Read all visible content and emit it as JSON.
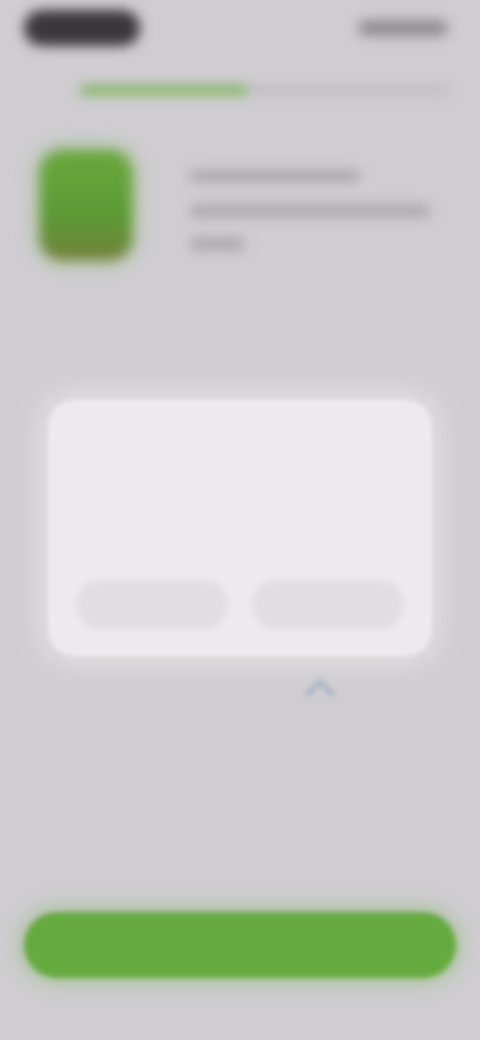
{
  "status_bar": {
    "time": "",
    "icons": "signal-wifi-battery"
  },
  "onboarding": {
    "progress": 0.45
  },
  "dialog": {
    "title": "",
    "body": "",
    "cancel_label": "",
    "confirm_label": ""
  },
  "cta": {
    "label": ""
  },
  "colors": {
    "accent": "#64aa3f",
    "background": "#cfcdd1",
    "dialog_bg": "#eceaee"
  }
}
